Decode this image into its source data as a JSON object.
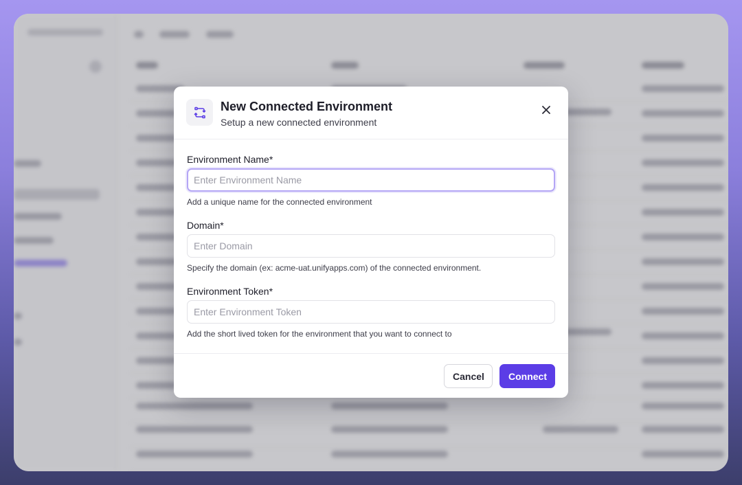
{
  "modal": {
    "title": "New Connected Environment",
    "subtitle": "Setup a new connected environment",
    "header_icon": "connected-environment-icon",
    "close_icon": "close-icon"
  },
  "fields": {
    "environment_name": {
      "label": "Environment Name*",
      "value": "",
      "placeholder": "Enter Environment Name",
      "help": "Add a unique name for the connected environment"
    },
    "domain": {
      "label": "Domain*",
      "value": "",
      "placeholder": "Enter Domain",
      "help": "Specify the domain (ex: acme-uat.unifyapps.com) of the connected environment."
    },
    "environment_token": {
      "label": "Environment Token*",
      "value": "",
      "placeholder": "Enter Environment Token",
      "help": "Add the short lived token for the environment that you want to connect to"
    }
  },
  "footer": {
    "cancel_label": "Cancel",
    "connect_label": "Connect"
  },
  "colors": {
    "accent": "#5b3de6",
    "focus_ring": "#b4a6f5",
    "backdrop_top": "#a596f0",
    "backdrop_bottom": "#3c3e6b"
  }
}
